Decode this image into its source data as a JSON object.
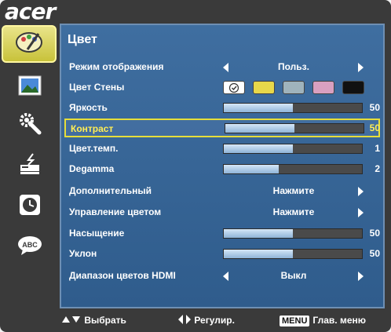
{
  "brand": "acer",
  "sidebar": {
    "items": [
      {
        "name": "color-palette-icon",
        "active": true
      },
      {
        "name": "picture-icon",
        "active": false
      },
      {
        "name": "settings-gear-icon",
        "active": false
      },
      {
        "name": "projector-icon",
        "active": false
      },
      {
        "name": "clock-icon",
        "active": false
      },
      {
        "name": "language-abc-icon",
        "active": false
      }
    ]
  },
  "panel": {
    "title": "Цвет",
    "rows": [
      {
        "label": "Режим отображения",
        "type": "option",
        "value": "Польз."
      },
      {
        "label": "Цвет Стены",
        "type": "swatches",
        "colors": [
          "#ffffff",
          "#e8d84a",
          "#9fb3bc",
          "#d9a0c0",
          "#111111"
        ]
      },
      {
        "label": "Яркость",
        "type": "bar",
        "value": "50",
        "fraction": 0.5
      },
      {
        "label": "Контраст",
        "type": "bar",
        "value": "50",
        "fraction": 0.5,
        "selected": true
      },
      {
        "label": "Цвет.темп.",
        "type": "bar",
        "value": "1",
        "fraction": 0.5
      },
      {
        "label": "Degamma",
        "type": "bar",
        "value": "2",
        "fraction": 0.4
      },
      {
        "label": "Дополнительный",
        "type": "option-right",
        "value": "Нажмите"
      },
      {
        "label": "Управление цветом",
        "type": "option-right",
        "value": "Нажмите"
      },
      {
        "label": "Насыщение",
        "type": "bar",
        "value": "50",
        "fraction": 0.5
      },
      {
        "label": "Уклон",
        "type": "bar",
        "value": "50",
        "fraction": 0.5
      },
      {
        "label": "Диапазон цветов HDMI",
        "type": "option",
        "value": "Выкл"
      }
    ]
  },
  "footer": {
    "select_label": "Выбрать",
    "adjust_label": "Регулир.",
    "menu_key": "MENU",
    "menu_label": "Глав. меню"
  },
  "colors": {
    "panel_bg": "#3f6ea0",
    "highlight": "#e6dd3a",
    "osd_bg": "#3a3a3a"
  }
}
